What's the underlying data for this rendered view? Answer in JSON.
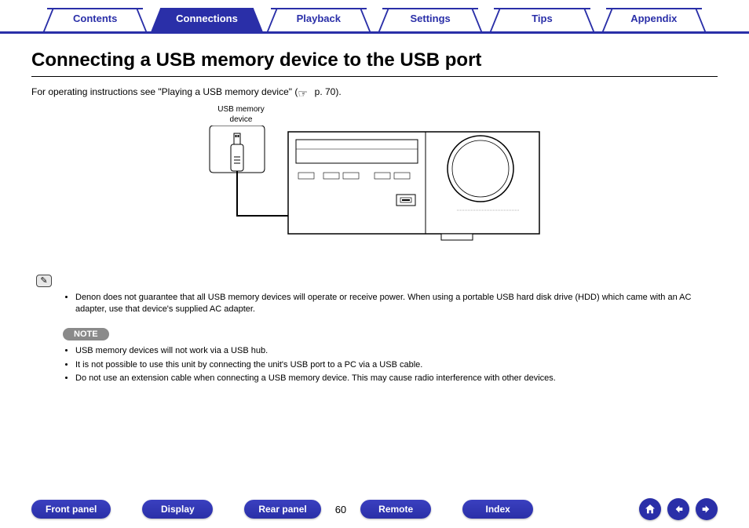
{
  "topnav": {
    "tabs": [
      {
        "label": "Contents",
        "active": false
      },
      {
        "label": "Connections",
        "active": true
      },
      {
        "label": "Playback",
        "active": false
      },
      {
        "label": "Settings",
        "active": false
      },
      {
        "label": "Tips",
        "active": false
      },
      {
        "label": "Appendix",
        "active": false
      }
    ]
  },
  "page": {
    "title": "Connecting a USB memory device to the USB port",
    "lead_before_link": "For operating instructions see \"Playing a USB memory device\"  (",
    "lead_link": " p. 70",
    "lead_after_link": ").",
    "number": "60"
  },
  "diagram": {
    "usb_label_line1": "USB memory",
    "usb_label_line2": "device"
  },
  "info_bullets": [
    "Denon does not guarantee that all USB memory devices will operate or receive power. When using a portable USB hard disk drive (HDD) which came with an AC adapter, use that device's supplied AC adapter."
  ],
  "note_heading": "NOTE",
  "note_bullets": [
    "USB memory devices will not work via a USB hub.",
    "It is not possible to use this unit by connecting the unit's USB port to a PC via a USB cable.",
    "Do not use an extension cable when connecting a USB memory device. This may cause radio interference with other devices."
  ],
  "bottom": {
    "buttons": [
      "Front panel",
      "Display",
      "Rear panel",
      "Remote",
      "Index"
    ]
  }
}
